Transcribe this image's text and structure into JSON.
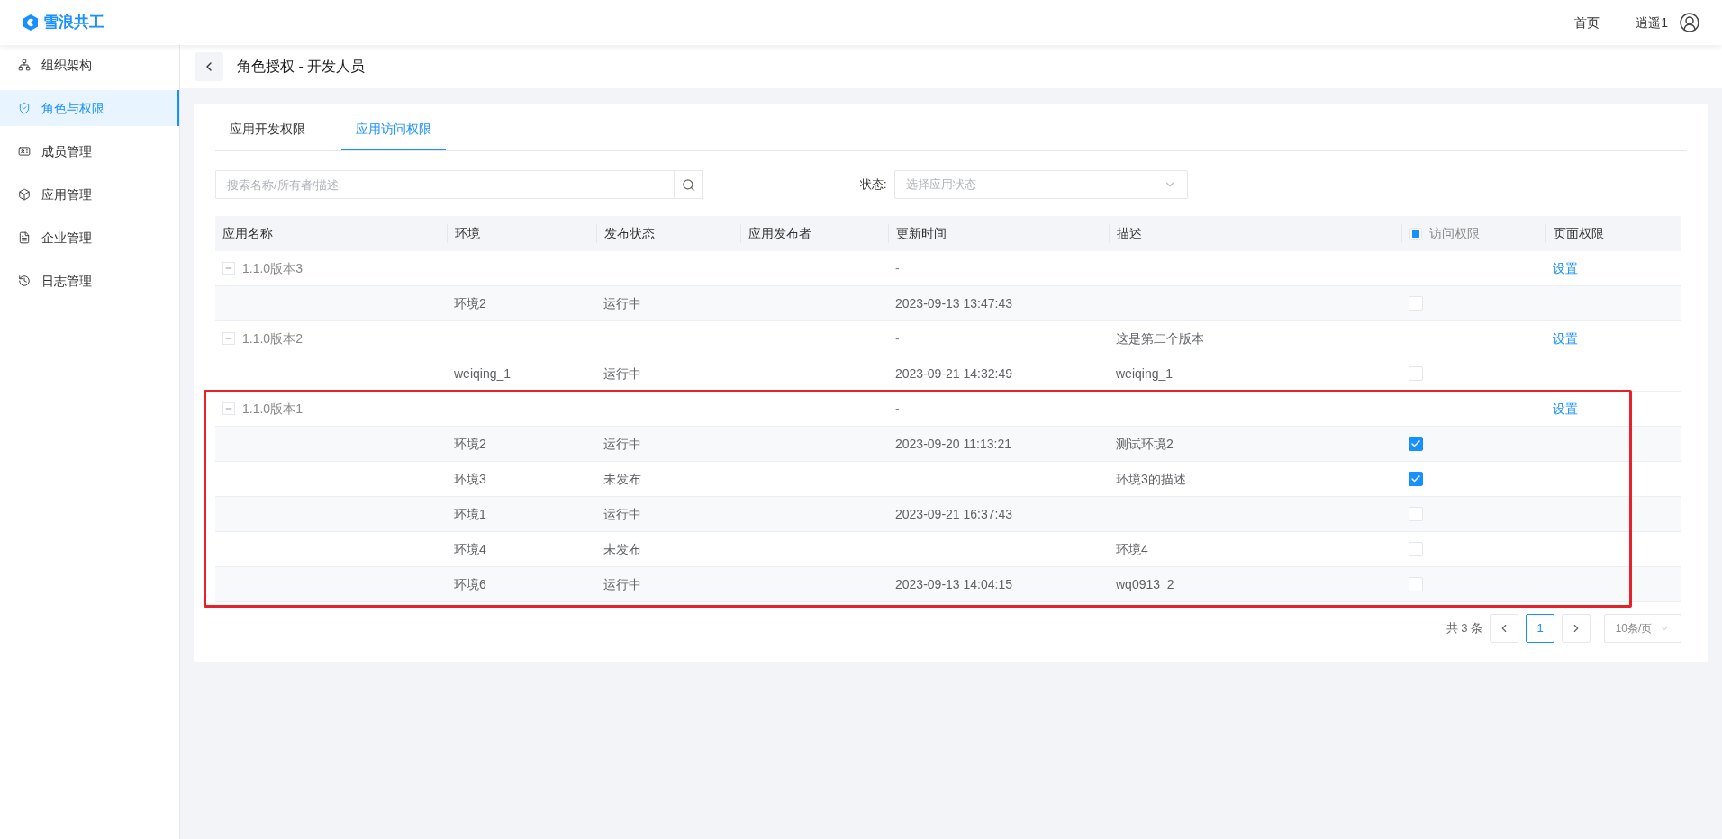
{
  "header": {
    "logo_text": "雪浪共工",
    "nav_link": "首页",
    "user_name": "逍遥1"
  },
  "sidebar": {
    "items": [
      {
        "label": "组织架构",
        "selected": false
      },
      {
        "label": "角色与权限",
        "selected": true
      },
      {
        "label": "成员管理",
        "selected": false
      },
      {
        "label": "应用管理",
        "selected": false
      },
      {
        "label": "企业管理",
        "selected": false
      },
      {
        "label": "日志管理",
        "selected": false
      }
    ]
  },
  "page_title": "角色授权 - 开发人员",
  "tabs": [
    {
      "label": "应用开发权限",
      "selected": false
    },
    {
      "label": "应用访问权限",
      "selected": true
    }
  ],
  "search": {
    "placeholder": "搜索名称/所有者/描述"
  },
  "status_filter": {
    "label": "状态:",
    "placeholder": "选择应用状态"
  },
  "table": {
    "columns": [
      "应用名称",
      "环境",
      "发布状态",
      "应用发布者",
      "更新时间",
      "描述",
      "访问权限",
      "页面权限"
    ],
    "access_header_indeterminate": true,
    "groups": [
      {
        "name": "1.1.0版本3",
        "expanded": true,
        "highlighted": false,
        "time": "-",
        "link": "设置",
        "rows": [
          {
            "env": "环境2",
            "status": "运行中",
            "time": "2023-09-13 13:47:43",
            "checked": false
          }
        ]
      },
      {
        "name": "1.1.0版本2",
        "expanded": true,
        "highlighted": false,
        "time": "-",
        "description": "这是第二个版本",
        "link": "设置",
        "rows": [
          {
            "env": "weiqing_1",
            "status": "运行中",
            "time": "2023-09-21 14:32:49",
            "description": "weiqing_1",
            "checked": false
          }
        ]
      },
      {
        "name": "1.1.0版本1",
        "expanded": true,
        "highlighted": true,
        "time": "-",
        "link": "设置",
        "rows": [
          {
            "env": "环境2",
            "status": "运行中",
            "time": "2023-09-20 11:13:21",
            "description": "测试环境2",
            "checked": true
          },
          {
            "env": "环境3",
            "status": "未发布",
            "description": "环境3的描述",
            "checked": true
          },
          {
            "env": "环境1",
            "status": "运行中",
            "time": "2023-09-21 16:37:43",
            "checked": false
          },
          {
            "env": "环境4",
            "status": "未发布",
            "description": "环境4",
            "checked": false
          },
          {
            "env": "环境6",
            "status": "运行中",
            "time": "2023-09-13 14:04:15",
            "description": "wq0913_2",
            "checked": false
          }
        ]
      }
    ]
  },
  "pagination": {
    "total": "共 3 条",
    "pages": [
      {
        "label": "1",
        "selected": true
      }
    ],
    "page_size": "10条/页"
  }
}
